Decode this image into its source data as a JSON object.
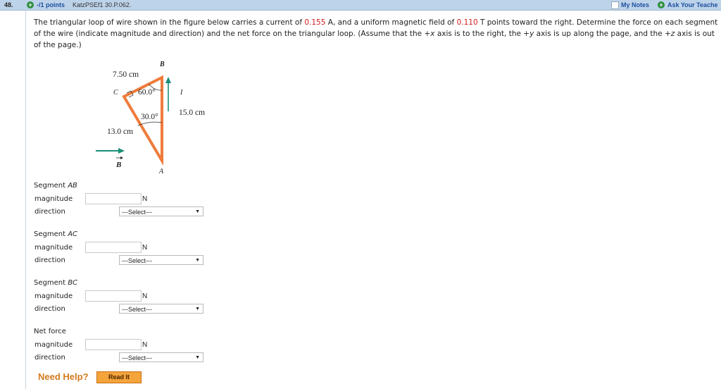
{
  "header": {
    "question_number": "48.",
    "points": "-/1 points",
    "source_id": "KatzPSEf1 30.P.062.",
    "my_notes": "My Notes",
    "ask_teacher": "Ask Your Teache"
  },
  "problem": {
    "part1": "The triangular loop of wire shown in the figure below carries a current of ",
    "current_value": "0.155",
    "part2": " A, and a uniform magnetic field of ",
    "field_value": "0.110",
    "part3": " T points toward the right. Determine the force on each segment of the wire (indicate magnitude and direction) and the net force on the triangular loop. (Assume that the +",
    "x": "x",
    "part4": " axis is to the right, the +",
    "y": "y",
    "part5": " axis is up along the page, and the +",
    "z": "z",
    "part6": " axis is out of the page.)"
  },
  "figure": {
    "label_B": "B",
    "label_C": "C",
    "label_A": "A",
    "label_I": "I",
    "len_CB": "7.50 cm",
    "len_AB": "15.0 cm",
    "len_AC": "13.0 cm",
    "angle_C_B": "60.0°",
    "angle_A": "30.0°",
    "field_label": "B",
    "colors": {
      "wire": "#ef7b3b",
      "arrow": "#1a8f7a"
    }
  },
  "segments": [
    {
      "title_prefix": "Segment ",
      "title_var": "AB",
      "magnitude_label": "magnitude",
      "direction_label": "direction",
      "magnitude_value": "",
      "unit": "N",
      "direction_selected": "---Select---"
    },
    {
      "title_prefix": "Segment ",
      "title_var": "AC",
      "magnitude_label": "magnitude",
      "direction_label": "direction",
      "magnitude_value": "",
      "unit": "N",
      "direction_selected": "---Select---"
    },
    {
      "title_prefix": "Segment ",
      "title_var": "BC",
      "magnitude_label": "magnitude",
      "direction_label": "direction",
      "magnitude_value": "",
      "unit": "N",
      "direction_selected": "---Select---"
    },
    {
      "title_prefix": "Net force",
      "title_var": "",
      "magnitude_label": "magnitude",
      "direction_label": "direction",
      "magnitude_value": "",
      "unit": "N",
      "direction_selected": "---Select---"
    }
  ],
  "help": {
    "label": "Need Help?",
    "read_it": "Read It"
  }
}
